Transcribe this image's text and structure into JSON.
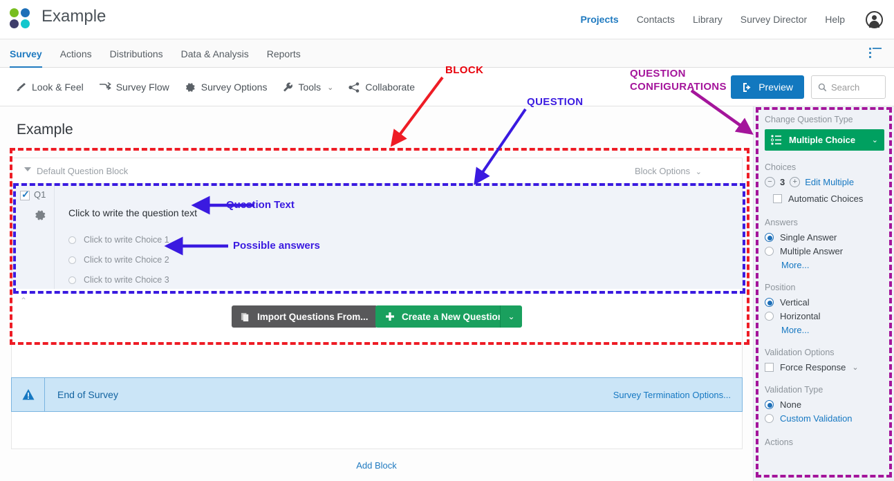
{
  "app": {
    "logo_name": "qualtrics-logo",
    "project_title": "Example",
    "project_caret": "⌄"
  },
  "topnav": {
    "items": [
      {
        "label": "Projects",
        "active": true
      },
      {
        "label": "Contacts",
        "active": false
      },
      {
        "label": "Library",
        "active": false
      },
      {
        "label": "Survey Director",
        "active": false
      },
      {
        "label": "Help",
        "active": false
      }
    ],
    "avatar_name": "user-avatar"
  },
  "tabs": [
    {
      "label": "Survey",
      "active": true
    },
    {
      "label": "Actions",
      "active": false
    },
    {
      "label": "Distributions",
      "active": false
    },
    {
      "label": "Data & Analysis",
      "active": false
    },
    {
      "label": "Reports",
      "active": false
    }
  ],
  "toolbar": {
    "items": [
      {
        "label": "Look & Feel",
        "icon": "paintbrush-icon"
      },
      {
        "label": "Survey Flow",
        "icon": "flow-arrows-icon"
      },
      {
        "label": "Survey Options",
        "icon": "gear-icon"
      },
      {
        "label": "Tools",
        "icon": "wrench-icon",
        "caret": "⌄"
      },
      {
        "label": "Collaborate",
        "icon": "share-nodes-icon"
      }
    ],
    "preview_label": "Preview",
    "search_placeholder": "Search"
  },
  "main": {
    "page_title": "Example",
    "block": {
      "name": "Default Question Block",
      "options_label": "Block Options",
      "options_caret": "⌄",
      "collapse_caret": "⌃"
    },
    "question": {
      "id": "Q1",
      "text": "Click to write the question text",
      "choices": [
        "Click to write Choice 1",
        "Click to write Choice 2",
        "Click to write Choice 3"
      ]
    },
    "buttons": {
      "import_label": "Import Questions From...",
      "create_label": "Create a New Question",
      "create_caret": "⌄"
    },
    "add_block_label": "Add Block",
    "end_of_survey": {
      "label": "End of Survey",
      "termination_label": "Survey Termination Options..."
    }
  },
  "right_panel": {
    "change_question_type_label": "Change Question Type",
    "question_type_value": "Multiple Choice",
    "question_type_caret": "⌄",
    "choices_label": "Choices",
    "choices_minus": "−",
    "choices_count": "3",
    "choices_plus": "+",
    "edit_multiple_label": "Edit Multiple",
    "automatic_choices_label": "Automatic Choices",
    "answers_label": "Answers",
    "single_answer_label": "Single Answer",
    "multiple_answer_label": "Multiple Answer",
    "answers_more_label": "More...",
    "position_label": "Position",
    "vertical_label": "Vertical",
    "horizontal_label": "Horizontal",
    "position_more_label": "More...",
    "validation_options_label": "Validation Options",
    "force_response_label": "Force Response",
    "force_response_caret": "⌄",
    "validation_type_label": "Validation Type",
    "none_label": "None",
    "custom_validation_label": "Custom Validation",
    "actions_label": "Actions"
  },
  "annotations": {
    "block": "BLOCK",
    "question": "QUESTION",
    "question_configurations_line1": "QUESTION",
    "question_configurations_line2": "CONFIGURATIONS",
    "question_text": "Question Text",
    "possible_answers": "Possible answers"
  },
  "colors": {
    "accent_blue": "#1f7ac0",
    "green": "#00a060",
    "dark_gray_button": "#58585a",
    "anno_red": "#ee1c25",
    "anno_blue": "#3a1ae0",
    "anno_purple": "#a4159b"
  }
}
